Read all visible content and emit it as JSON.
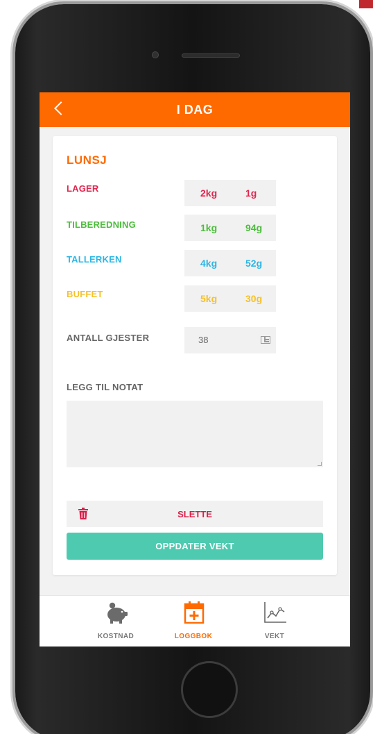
{
  "header": {
    "title": "I DAG",
    "back_icon": "chevron-left-icon"
  },
  "section": {
    "title": "LUNSJ"
  },
  "rows": [
    {
      "label": "LAGER",
      "kg": "2kg",
      "g": "1g",
      "color": "#e2254e"
    },
    {
      "label": "TILBEREDNING",
      "kg": "1kg",
      "g": "94g",
      "color": "#4cbc3c"
    },
    {
      "label": "TALLERKEN",
      "kg": "4kg",
      "g": "52g",
      "color": "#2bb6e4"
    },
    {
      "label": "BUFFET",
      "kg": "5kg",
      "g": "30g",
      "color": "#f6c12a"
    }
  ],
  "guests": {
    "label": "ANTALL GJESTER",
    "value": "38",
    "icon": "calculator-icon"
  },
  "note": {
    "label": "LEGG TIL NOTAT",
    "value": ""
  },
  "actions": {
    "delete_label": "SLETTE",
    "delete_icon": "trash-icon",
    "update_label": "OPPDATER VEKT"
  },
  "nav": [
    {
      "label": "KOSTNAD",
      "icon": "piggy-bank-icon",
      "active": false
    },
    {
      "label": "LOGGBOK",
      "icon": "calendar-plus-icon",
      "active": true
    },
    {
      "label": "VEKT",
      "icon": "line-chart-icon",
      "active": false
    }
  ],
  "colors": {
    "accent": "#ff6a00",
    "primary_button": "#4ecab0",
    "danger": "#d9204a",
    "nav_inactive": "#777777"
  }
}
